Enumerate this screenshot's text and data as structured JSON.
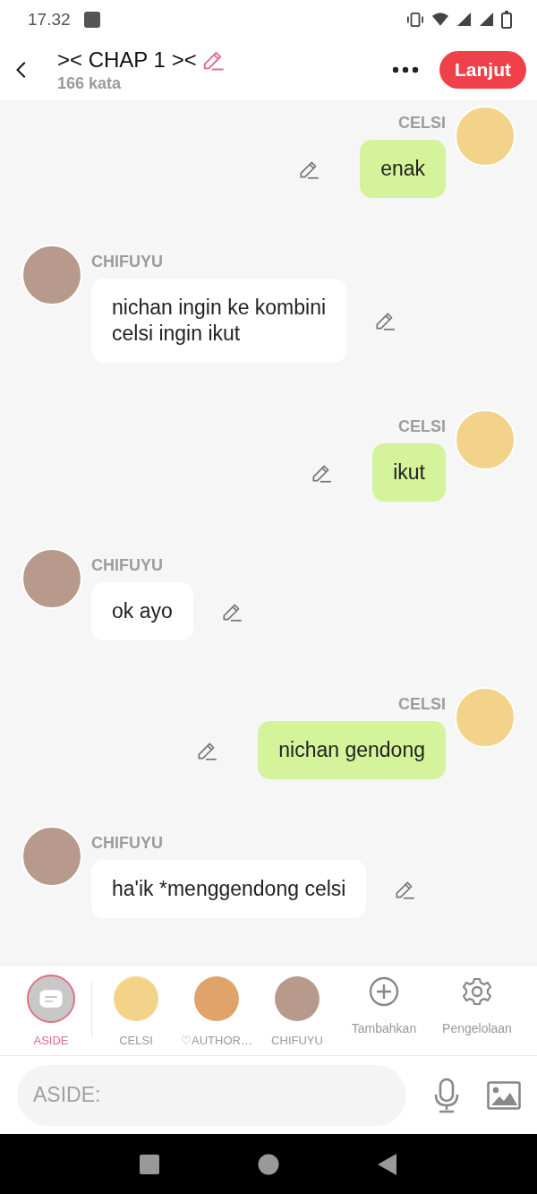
{
  "status_bar": {
    "time": "17.32"
  },
  "header": {
    "title": ">< CHAP 1 ><",
    "word_count": "166 kata",
    "next_button": "Lanjut"
  },
  "messages": [
    {
      "kind": "outgoing",
      "name": "CELSI",
      "text": "enak",
      "color": "#f3d38a"
    },
    {
      "kind": "incoming",
      "name": "CHIFUYU",
      "text": "nichan ingin ke kombini\ncelsi ingin ikut",
      "color": "#b89a8c"
    },
    {
      "kind": "outgoing",
      "name": "CELSI",
      "text": "ikut",
      "color": "#f3d38a"
    },
    {
      "kind": "incoming",
      "name": "CHIFUYU",
      "text": "ok ayo",
      "color": "#b89a8c"
    },
    {
      "kind": "outgoing",
      "name": "CELSI",
      "text": "nichan gendong",
      "color": "#f3d38a"
    },
    {
      "kind": "incoming",
      "name": "CHIFUYU",
      "text": "ha'ik *menggendong celsi",
      "color": "#b89a8c"
    }
  ],
  "speakers": [
    {
      "kind": "aside",
      "label": "ASIDE",
      "selected": true
    },
    {
      "kind": "character",
      "label": "CELSI",
      "selected": false,
      "color": "#f3d38a"
    },
    {
      "kind": "character",
      "label": "♡AUTHOR…",
      "selected": false,
      "color": "#e0a36a"
    },
    {
      "kind": "character",
      "label": "CHIFUYU",
      "selected": false,
      "color": "#b89a8c"
    },
    {
      "kind": "add",
      "label": "Tambahkan",
      "selected": false
    },
    {
      "kind": "settings",
      "label": "Pengelolaan",
      "selected": false
    }
  ],
  "composer": {
    "placeholder": "ASIDE:"
  }
}
